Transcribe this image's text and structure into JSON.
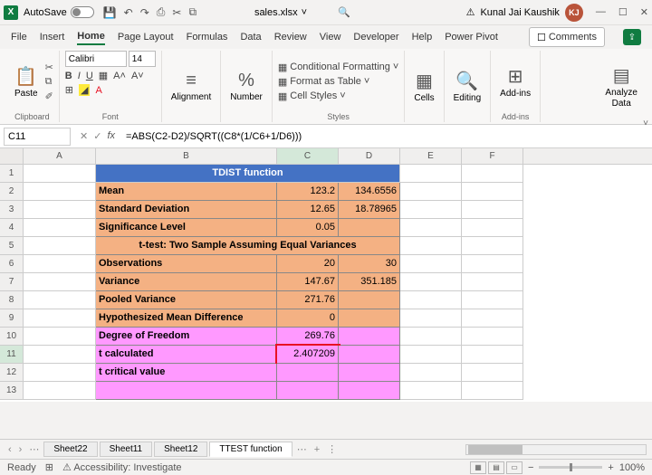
{
  "title": {
    "autosave": "AutoSave",
    "filename": "sales.xlsx",
    "user": "Kunal Jai Kaushik",
    "initials": "KJ"
  },
  "tabs": {
    "file": "File",
    "insert": "Insert",
    "home": "Home",
    "pagelayout": "Page Layout",
    "formulas": "Formulas",
    "data": "Data",
    "review": "Review",
    "view": "View",
    "developer": "Developer",
    "help": "Help",
    "powerpivot": "Power Pivot",
    "comments": "Comments"
  },
  "ribbon": {
    "paste": "Paste",
    "clipboard": "Clipboard",
    "fontname": "Calibri",
    "fontsize": "14",
    "under": "U",
    "font": "Font",
    "alignment": "Alignment",
    "number": "Number",
    "condfmt": "Conditional Formatting",
    "fmttable": "Format as Table",
    "cellstyles": "Cell Styles",
    "styles": "Styles",
    "cells": "Cells",
    "editing": "Editing",
    "addins": "Add-ins",
    "addinsg": "Add-ins",
    "analyze": "Analyze",
    "analyzedata": "Data"
  },
  "fbar": {
    "name": "C11",
    "formula": "=ABS(C2-D2)/SQRT((C8*(1/C6+1/D6)))"
  },
  "cols": {
    "A": "A",
    "B": "B",
    "C": "C",
    "D": "D",
    "E": "E",
    "F": "F"
  },
  "rows": {
    "1": "1",
    "2": "2",
    "3": "3",
    "4": "4",
    "5": "5",
    "6": "6",
    "7": "7",
    "8": "8",
    "9": "9",
    "10": "10",
    "11": "11",
    "12": "12",
    "13": "13"
  },
  "cells": {
    "r1": "TDIST function",
    "r2b": "Mean",
    "r2c": "123.2",
    "r2d": "134.6556",
    "r3b": "Standard Deviation",
    "r3c": "12.65",
    "r3d": "18.78965",
    "r4b": "Significance Level",
    "r4c": "0.05",
    "r5": "t-test: Two Sample Assuming Equal Variances",
    "r6b": "Observations",
    "r6c": "20",
    "r6d": "30",
    "r7b": "Variance",
    "r7c": "147.67",
    "r7d": "351.185",
    "r8b": "Pooled Variance",
    "r8c": "271.76",
    "r9b": "Hypothesized Mean Difference",
    "r9c": "0",
    "r10b": "Degree of Freedom",
    "r10c": "269.76",
    "r11b": "t calculated",
    "r11c": "2.407209",
    "r12b": "t critical value"
  },
  "sheets": {
    "s1": "Sheet22",
    "s2": "Sheet11",
    "s3": "Sheet12",
    "s4": "TTEST function"
  },
  "status": {
    "ready": "Ready",
    "acc": "Accessibility: Investigate",
    "zoom": "100%"
  }
}
